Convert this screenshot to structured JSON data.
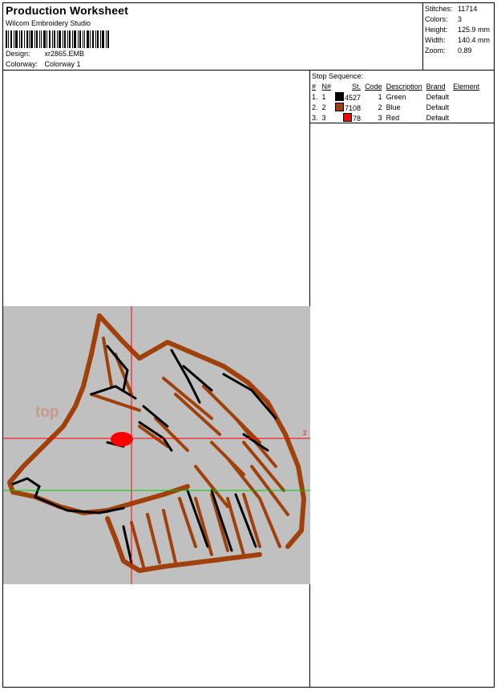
{
  "header": {
    "title": "Production Worksheet",
    "software": "Wilcom  Embroidery Studio",
    "design_label": "Design:",
    "design_value": "xr2865.EMB",
    "colorway_label": "Colorway:",
    "colorway_value": "Colorway 1"
  },
  "stats": [
    {
      "label": "Stitches:",
      "value": "11714"
    },
    {
      "label": "Colors:",
      "value": "3"
    },
    {
      "label": "Height:",
      "value": "125.9 mm"
    },
    {
      "label": "Width:",
      "value": "140.4 mm"
    },
    {
      "label": "Zoom:",
      "value": "0.89"
    }
  ],
  "stop_sequence": {
    "title": "Stop Sequence:",
    "columns": [
      "#",
      "N#",
      "St.",
      "Code",
      "Description",
      "Brand",
      "Element"
    ],
    "rows": [
      {
        "num": "1.",
        "n": "1",
        "color": "#000000",
        "st": "4527",
        "code": "1",
        "description": "Green",
        "brand": "Default",
        "element": ""
      },
      {
        "num": "2.",
        "n": "2",
        "color": "#a0400a",
        "st": "7108",
        "code": "2",
        "description": "Blue",
        "brand": "Default",
        "element": ""
      },
      {
        "num": "3.",
        "n": "3",
        "color": "#ff0000",
        "st": "78",
        "code": "3",
        "description": "Red",
        "brand": "Default",
        "element": ""
      }
    ]
  },
  "design_view": {
    "background": "#c0c0c0",
    "guide_colors": {
      "crosshair": "#ff0000",
      "baseline": "#00cc00"
    },
    "thread_colors": [
      "#000000",
      "#a0400a",
      "#ff0000"
    ],
    "marker_label": "2",
    "watermark": "top"
  }
}
